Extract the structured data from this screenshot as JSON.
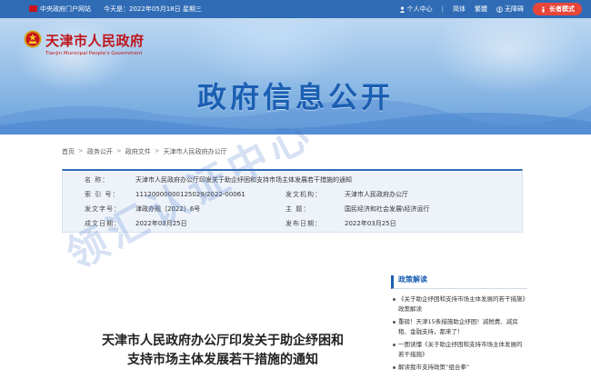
{
  "topbar": {
    "central_portal": "中央政府门户网站",
    "today": "今天是：2022年05月18日 星期三",
    "personal_center": "个人中心",
    "simplified": "简体",
    "traditional": "繁體",
    "accessibility": "无障碍",
    "elder_mode": "长者模式"
  },
  "header": {
    "site_name": "天津市人民政府",
    "site_name_en": "Tianjin Municipal People's Government",
    "banner_title": "政府信息公开"
  },
  "breadcrumb": [
    "首页",
    "政务公开",
    "政府文件",
    "天津市人民政府办公厅"
  ],
  "info": {
    "name_label": "名    称：",
    "name_value": "天津市人民政府办公厅印发关于助企纾困和支持市场主体发展若干措施的通知",
    "index_label": "索 引 号：",
    "index_value": "11120000000125029/2022-00061",
    "issuer_label": "发文机构：",
    "issuer_value": "天津市人民政府办公厅",
    "docno_label": "发文字号：",
    "docno_value": "津政办规〔2022〕6号",
    "subject_label": "主    题：",
    "subject_value": "国民经济和社会发展\\经济运行",
    "created_label": "成文日期：",
    "created_value": "2022年03月25日",
    "published_label": "发布日期：",
    "published_value": "2022年03月25日"
  },
  "watermark": "领汇认证中心",
  "policy": {
    "heading": "政策解读",
    "items": [
      "《关于助企纾困和支持市场主体发展的若干措施》政策解读",
      "重磅！天津15条措施助企纾困！减税费、减房租、金融支持，都来了！",
      "一图读懂《关于助企纾困和支持市场主体发展的若干措施》",
      "解读我市支持政策“组合拳”"
    ]
  },
  "article": {
    "title_line1": "天津市人民政府办公厅印发关于助企纾困和",
    "title_line2": "支持市场主体发展若干措施的通知"
  }
}
